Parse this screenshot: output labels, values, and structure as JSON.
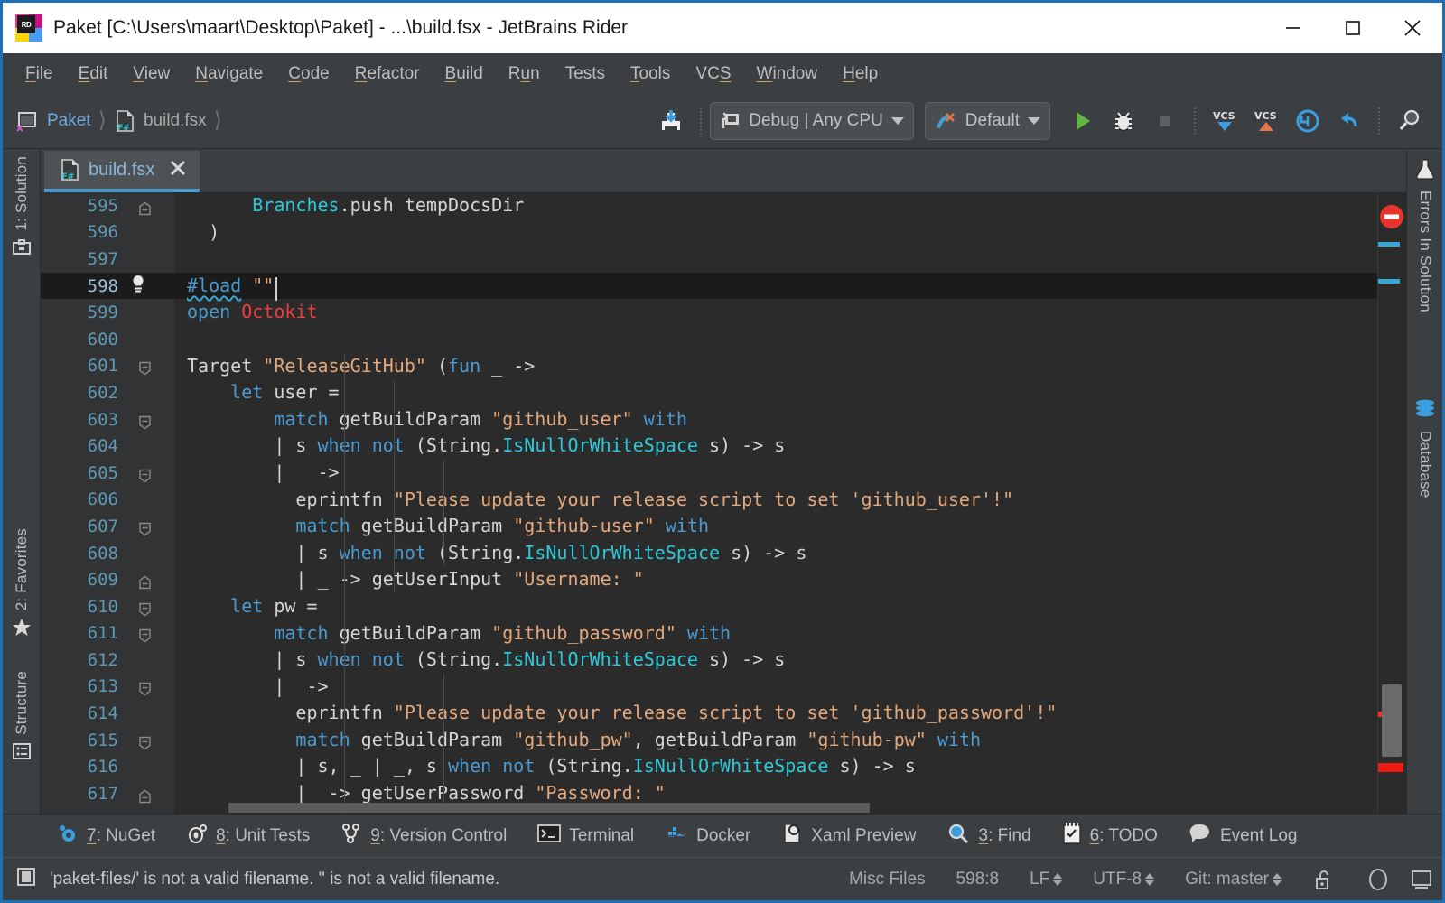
{
  "window": {
    "title": "Paket [C:\\Users\\maart\\Desktop\\Paket] - ...\\build.fsx - JetBrains Rider",
    "logo_badge": "RD",
    "minimize_label": "Minimize",
    "maximize_label": "Maximize",
    "close_label": "Close"
  },
  "menubar": {
    "items": [
      {
        "label": "File",
        "mnemonic": "F"
      },
      {
        "label": "Edit",
        "mnemonic": "E"
      },
      {
        "label": "View",
        "mnemonic": "V"
      },
      {
        "label": "Navigate",
        "mnemonic": "N"
      },
      {
        "label": "Code",
        "mnemonic": "C"
      },
      {
        "label": "Refactor",
        "mnemonic": "R"
      },
      {
        "label": "Build",
        "mnemonic": "B"
      },
      {
        "label": "Run",
        "mnemonic": "u"
      },
      {
        "label": "Tests",
        "mnemonic": ""
      },
      {
        "label": "Tools",
        "mnemonic": "T"
      },
      {
        "label": "VCS",
        "mnemonic": "S"
      },
      {
        "label": "Window",
        "mnemonic": "W"
      },
      {
        "label": "Help",
        "mnemonic": "H"
      }
    ]
  },
  "toolbar": {
    "breadcrumb": {
      "project": "Paket",
      "file": "build.fsx"
    },
    "save_all_icon": "save-all-icon",
    "configuration": {
      "label": "Debug | Any CPU",
      "icon": "build-configuration-icon"
    },
    "run_config": {
      "label": "Default",
      "icon": "run-configuration-icon"
    },
    "run_icon": "run-icon",
    "debug_icon": "debug-icon",
    "stop_icon": "stop-icon",
    "vcs_update_icon": "vcs-update-icon",
    "vcs_commit_icon": "vcs-commit-icon",
    "rollback_icon": "rollback-icon",
    "undo_icon": "undo-icon",
    "search_icon": "search-everywhere-icon"
  },
  "left_rail": {
    "items": [
      {
        "label": "1: Solution",
        "icon": "solution-icon"
      },
      {
        "label": "2: Favorites",
        "icon": "star-icon"
      },
      {
        "label": "Structure",
        "icon": "structure-icon"
      }
    ]
  },
  "right_rail": {
    "items": [
      {
        "label": "Errors In Solution",
        "icon": "flask-icon"
      },
      {
        "label": "Database",
        "icon": "database-icon"
      }
    ]
  },
  "editor": {
    "tab": {
      "label": "build.fsx",
      "icon": "fsharp-file-icon",
      "close_icon": "close-icon"
    },
    "caret_position": "598:8",
    "current_line": 598,
    "first_line": 595,
    "lines": [
      {
        "n": 595,
        "fold": "end",
        "tokens": [
          {
            "t": "      ",
            "c": "t-def"
          },
          {
            "t": "Branches",
            "c": "t-type"
          },
          {
            "t": ".push tempDocsDir",
            "c": "t-def"
          }
        ]
      },
      {
        "n": 596,
        "fold": "",
        "tokens": [
          {
            "t": "  )",
            "c": "t-def"
          }
        ]
      },
      {
        "n": 597,
        "fold": "",
        "tokens": []
      },
      {
        "n": 598,
        "fold": "",
        "bulb": true,
        "tokens": [
          {
            "t": "#load",
            "c": "t-kw squig"
          },
          {
            "t": " ",
            "c": "t-def"
          },
          {
            "t": "\"\"",
            "c": "t-str"
          }
        ]
      },
      {
        "n": 599,
        "fold": "",
        "tokens": [
          {
            "t": "open",
            "c": "t-kw"
          },
          {
            "t": " ",
            "c": "t-def"
          },
          {
            "t": "Octokit",
            "c": "t-red"
          }
        ]
      },
      {
        "n": 600,
        "fold": "",
        "tokens": []
      },
      {
        "n": 601,
        "fold": "start",
        "tokens": [
          {
            "t": "Target ",
            "c": "t-def"
          },
          {
            "t": "\"ReleaseGitHub\"",
            "c": "t-str"
          },
          {
            "t": " (",
            "c": "t-def"
          },
          {
            "t": "fun",
            "c": "t-kw"
          },
          {
            "t": " _ ->",
            "c": "t-def"
          }
        ]
      },
      {
        "n": 602,
        "fold": "",
        "tokens": [
          {
            "t": "    ",
            "c": "t-def"
          },
          {
            "t": "let",
            "c": "t-kw"
          },
          {
            "t": " user =",
            "c": "t-def"
          }
        ]
      },
      {
        "n": 603,
        "fold": "start",
        "tokens": [
          {
            "t": "        ",
            "c": "t-def"
          },
          {
            "t": "match",
            "c": "t-kw"
          },
          {
            "t": " getBuildParam ",
            "c": "t-def"
          },
          {
            "t": "\"github_user\"",
            "c": "t-str"
          },
          {
            "t": " ",
            "c": "t-def"
          },
          {
            "t": "with",
            "c": "t-kw"
          }
        ]
      },
      {
        "n": 604,
        "fold": "",
        "tokens": [
          {
            "t": "        | s ",
            "c": "t-def"
          },
          {
            "t": "when",
            "c": "t-kw"
          },
          {
            "t": " ",
            "c": "t-def"
          },
          {
            "t": "not",
            "c": "t-kw"
          },
          {
            "t": " (String.",
            "c": "t-def"
          },
          {
            "t": "IsNullOrWhiteSpace",
            "c": "t-type"
          },
          {
            "t": " s) -> s",
            "c": "t-def"
          }
        ]
      },
      {
        "n": 605,
        "fold": "start",
        "tokens": [
          {
            "t": "        |   ->",
            "c": "t-def"
          }
        ]
      },
      {
        "n": 606,
        "fold": "",
        "tokens": [
          {
            "t": "          eprintfn ",
            "c": "t-def"
          },
          {
            "t": "\"Please update your release script to set 'github_user'!\"",
            "c": "t-str"
          }
        ]
      },
      {
        "n": 607,
        "fold": "start",
        "tokens": [
          {
            "t": "          ",
            "c": "t-def"
          },
          {
            "t": "match",
            "c": "t-kw"
          },
          {
            "t": " getBuildParam ",
            "c": "t-def"
          },
          {
            "t": "\"github-user\"",
            "c": "t-str"
          },
          {
            "t": " ",
            "c": "t-def"
          },
          {
            "t": "with",
            "c": "t-kw"
          }
        ]
      },
      {
        "n": 608,
        "fold": "",
        "tokens": [
          {
            "t": "          | s ",
            "c": "t-def"
          },
          {
            "t": "when",
            "c": "t-kw"
          },
          {
            "t": " ",
            "c": "t-def"
          },
          {
            "t": "not",
            "c": "t-kw"
          },
          {
            "t": " (String.",
            "c": "t-def"
          },
          {
            "t": "IsNullOrWhiteSpace",
            "c": "t-type"
          },
          {
            "t": " s) -> s",
            "c": "t-def"
          }
        ]
      },
      {
        "n": 609,
        "fold": "end",
        "tokens": [
          {
            "t": "          | _ -> getUserInput ",
            "c": "t-def"
          },
          {
            "t": "\"Username: \"",
            "c": "t-str"
          }
        ]
      },
      {
        "n": 610,
        "fold": "start",
        "tokens": [
          {
            "t": "    ",
            "c": "t-def"
          },
          {
            "t": "let",
            "c": "t-kw"
          },
          {
            "t": " pw =",
            "c": "t-def"
          }
        ]
      },
      {
        "n": 611,
        "fold": "start",
        "tokens": [
          {
            "t": "        ",
            "c": "t-def"
          },
          {
            "t": "match",
            "c": "t-kw"
          },
          {
            "t": " getBuildParam ",
            "c": "t-def"
          },
          {
            "t": "\"github_password\"",
            "c": "t-str"
          },
          {
            "t": " ",
            "c": "t-def"
          },
          {
            "t": "with",
            "c": "t-kw"
          }
        ]
      },
      {
        "n": 612,
        "fold": "",
        "tokens": [
          {
            "t": "        | s ",
            "c": "t-def"
          },
          {
            "t": "when",
            "c": "t-kw"
          },
          {
            "t": " ",
            "c": "t-def"
          },
          {
            "t": "not",
            "c": "t-kw"
          },
          {
            "t": " (String.",
            "c": "t-def"
          },
          {
            "t": "IsNullOrWhiteSpace",
            "c": "t-type"
          },
          {
            "t": " s) -> s",
            "c": "t-def"
          }
        ]
      },
      {
        "n": 613,
        "fold": "start",
        "tokens": [
          {
            "t": "        |  ->",
            "c": "t-def"
          }
        ]
      },
      {
        "n": 614,
        "fold": "",
        "tokens": [
          {
            "t": "          eprintfn ",
            "c": "t-def"
          },
          {
            "t": "\"Please update your release script to set 'github_password'!\"",
            "c": "t-str"
          }
        ]
      },
      {
        "n": 615,
        "fold": "start",
        "tokens": [
          {
            "t": "          ",
            "c": "t-def"
          },
          {
            "t": "match",
            "c": "t-kw"
          },
          {
            "t": " getBuildParam ",
            "c": "t-def"
          },
          {
            "t": "\"github_pw\"",
            "c": "t-str"
          },
          {
            "t": ", getBuildParam ",
            "c": "t-def"
          },
          {
            "t": "\"github-pw\"",
            "c": "t-str"
          },
          {
            "t": " ",
            "c": "t-def"
          },
          {
            "t": "with",
            "c": "t-kw"
          }
        ]
      },
      {
        "n": 616,
        "fold": "",
        "tokens": [
          {
            "t": "          | s, _ | _, s ",
            "c": "t-def"
          },
          {
            "t": "when",
            "c": "t-kw"
          },
          {
            "t": " ",
            "c": "t-def"
          },
          {
            "t": "not",
            "c": "t-kw"
          },
          {
            "t": " (String.",
            "c": "t-def"
          },
          {
            "t": "IsNullOrWhiteSpace",
            "c": "t-type"
          },
          {
            "t": " s) -> s",
            "c": "t-def"
          }
        ]
      },
      {
        "n": 617,
        "fold": "end",
        "tokens": [
          {
            "t": "          |  -> getUserPassword ",
            "c": "t-def"
          },
          {
            "t": "\"Password: \"",
            "c": "t-str"
          }
        ]
      }
    ]
  },
  "toolwindows": {
    "items": [
      {
        "label": "7: NuGet",
        "icon": "nuget-icon"
      },
      {
        "label": "8: Unit Tests",
        "icon": "unit-tests-icon"
      },
      {
        "label": "9: Version Control",
        "icon": "version-control-icon"
      },
      {
        "label": "Terminal",
        "icon": "terminal-icon"
      },
      {
        "label": "Docker",
        "icon": "docker-icon"
      },
      {
        "label": "Xaml Preview",
        "icon": "xaml-preview-icon"
      },
      {
        "label": "3: Find",
        "icon": "find-icon"
      },
      {
        "label": "6: TODO",
        "icon": "todo-icon"
      },
      {
        "label": "Event Log",
        "icon": "event-log-icon"
      }
    ]
  },
  "statusbar": {
    "message": "'paket-files/' is not a valid filename. '' is not a valid filename.",
    "message_icon": "inspection-icon",
    "scope": "Misc Files",
    "position": "598:8",
    "line_separator": "LF",
    "encoding": "UTF-8",
    "branch": "Git: master",
    "lock_icon": "unlocked-icon",
    "memory_icon": "memory-indicator-icon",
    "ide_icon": "ide-icon"
  },
  "colors": {
    "accent": "#1f6fb5",
    "tab_underline": "#4a9bd1",
    "error": "#f03e3e",
    "marker": "#39a7d4",
    "editor_bg": "#2b2b2b",
    "chrome_bg": "#3c3f41"
  }
}
